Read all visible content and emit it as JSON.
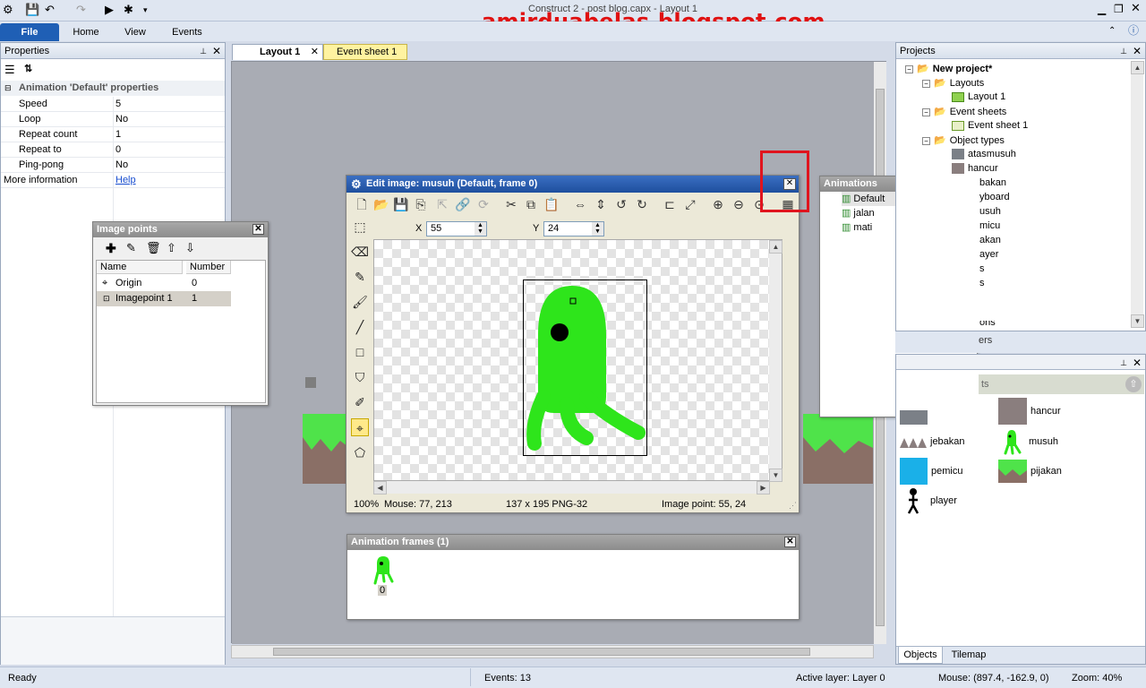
{
  "window": {
    "title": "Construct 2 - post blog.capx - Layout 1"
  },
  "watermark": "amirduabelas.blogspot.com",
  "ribbon": {
    "tabs": [
      "File",
      "Home",
      "View",
      "Events"
    ]
  },
  "doc_tabs": [
    "Layout 1",
    "Event sheet 1"
  ],
  "properties": {
    "title": "Properties",
    "section": "Animation 'Default' properties",
    "rows": [
      {
        "key": "Speed",
        "value": "5"
      },
      {
        "key": "Loop",
        "value": "No"
      },
      {
        "key": "Repeat count",
        "value": "1"
      },
      {
        "key": "Repeat to",
        "value": "0"
      },
      {
        "key": "Ping-pong",
        "value": "No"
      }
    ],
    "more_info_label": "More information",
    "more_info_link": "Help"
  },
  "image_points": {
    "title": "Image points",
    "columns": [
      "Name",
      "Number"
    ],
    "rows": [
      {
        "name": "Origin",
        "number": "0"
      },
      {
        "name": "Imagepoint 1",
        "number": "1"
      }
    ]
  },
  "edit_image": {
    "title": "Edit image: musuh (Default, frame 0)",
    "x_label": "X",
    "x_value": "55",
    "y_label": "Y",
    "y_value": "24",
    "status": {
      "zoom": "100%",
      "mouse": "Mouse: 77, 213",
      "size": "137 x 195  PNG-32",
      "point": "Image point: 55, 24"
    }
  },
  "animations": {
    "title": "Animations",
    "items": [
      "Default",
      "jalan",
      "mati"
    ]
  },
  "animation_frames": {
    "title": "Animation frames (1)",
    "frame_label": "0"
  },
  "projects": {
    "title": "Projects",
    "root": "New project*",
    "folders": [
      {
        "name": "Layouts",
        "items": [
          "Layout 1"
        ]
      },
      {
        "name": "Event sheets",
        "items": [
          "Event sheet 1"
        ]
      },
      {
        "name": "Object types",
        "items": [
          "atasmusuh",
          "hancur"
        ]
      }
    ],
    "partial_items": [
      "bakan",
      "yboard",
      "usuh",
      "micu",
      "akan",
      "ayer",
      "s",
      "s",
      "ons"
    ]
  },
  "layers_partial": "ers",
  "objects_panel": {
    "tabs": [
      "Objects",
      "Tilemap"
    ],
    "partial_header": "ts",
    "items": [
      "hancur",
      "jebakan",
      "musuh",
      "pemicu",
      "pijakan",
      "player"
    ]
  },
  "statusbar": {
    "ready": "Ready",
    "events": "Events: 13",
    "layer": "Active layer: Layer 0",
    "mouse": "Mouse: (897.4, -162.9, 0)",
    "zoom": "Zoom: 40%"
  },
  "colors": {
    "accent": "#1f5fb5",
    "highlight_box": "#e0141e",
    "sprite_green": "#2ee51b",
    "watermark": "#e01010"
  }
}
